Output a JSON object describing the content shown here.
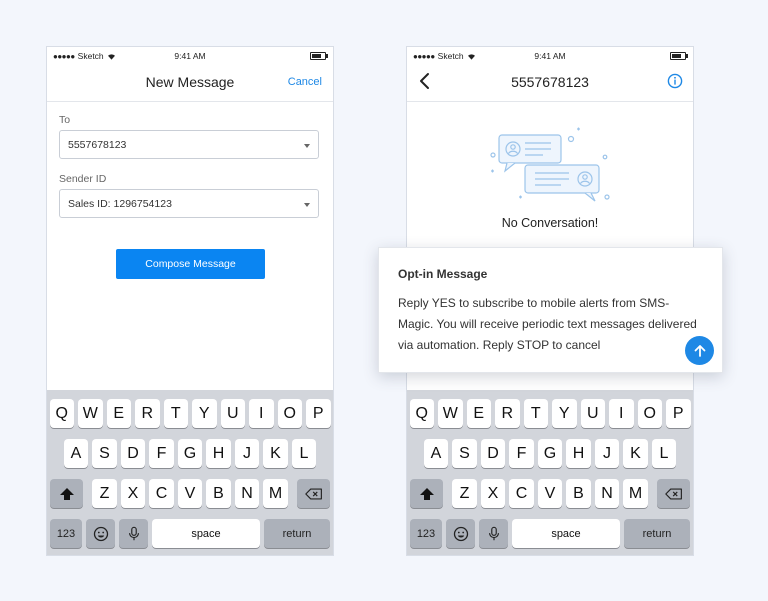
{
  "status_bar": {
    "carrier": "Sketch",
    "signal_dots": "●●●●●",
    "time": "9:41 AM"
  },
  "new_message_screen": {
    "title": "New Message",
    "cancel_label": "Cancel",
    "to_label": "To",
    "to_value": "5557678123",
    "sender_label": "Sender ID",
    "sender_value": "Sales ID: 1296754123",
    "compose_label": "Compose Message"
  },
  "conversation_screen": {
    "title": "5557678123",
    "empty_text": "No Conversation!",
    "optin_title": "Opt-in Message",
    "optin_body": "Reply YES to subscribe to mobile alerts from SMS-Magic. You will receive periodic text messages delivered via automation. Reply STOP to cancel"
  },
  "keyboard": {
    "row1": [
      "Q",
      "W",
      "E",
      "R",
      "T",
      "Y",
      "U",
      "I",
      "O",
      "P"
    ],
    "row2": [
      "A",
      "S",
      "D",
      "F",
      "G",
      "H",
      "J",
      "K",
      "L"
    ],
    "row3": [
      "Z",
      "X",
      "C",
      "V",
      "B",
      "N",
      "M"
    ],
    "numbers_label": "123",
    "space_label": "space",
    "return_label": "return",
    "icons": [
      "shift-icon",
      "delete-icon",
      "emoji-icon",
      "mic-icon"
    ]
  },
  "colors": {
    "accent": "#1e88e5",
    "button": "#0a85f2",
    "keyboard_bg": "#d2d5db",
    "page_bg": "#f3f6fc"
  }
}
